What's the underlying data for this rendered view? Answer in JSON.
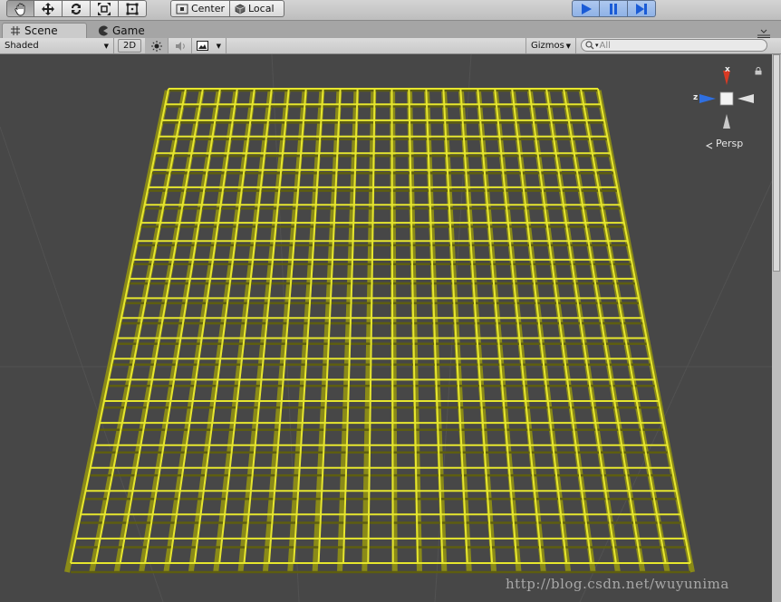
{
  "toolbar": {
    "pivot_label": "Center",
    "rotation_label": "Local"
  },
  "tabs": [
    {
      "label": "Scene"
    },
    {
      "label": "Game"
    }
  ],
  "scenebar": {
    "shading_mode": "Shaded",
    "mode_2d": "2D",
    "gizmos_label": "Gizmos",
    "search_placeholder": "All"
  },
  "gizmo": {
    "x_label": "x",
    "z_label": "z",
    "projection_label": "Persp"
  },
  "scene": {
    "grid_rows": 24,
    "grid_cols": 25,
    "grid_color": "#e6e62e",
    "grid_shadow": "#5e5e10",
    "background": "#474747"
  },
  "watermark": "http://blog.csdn.net/wuyunima",
  "colors": {
    "play_accent": "#1a5bd6",
    "axis_x": "#d93a24",
    "axis_z": "#2f6fe0"
  }
}
